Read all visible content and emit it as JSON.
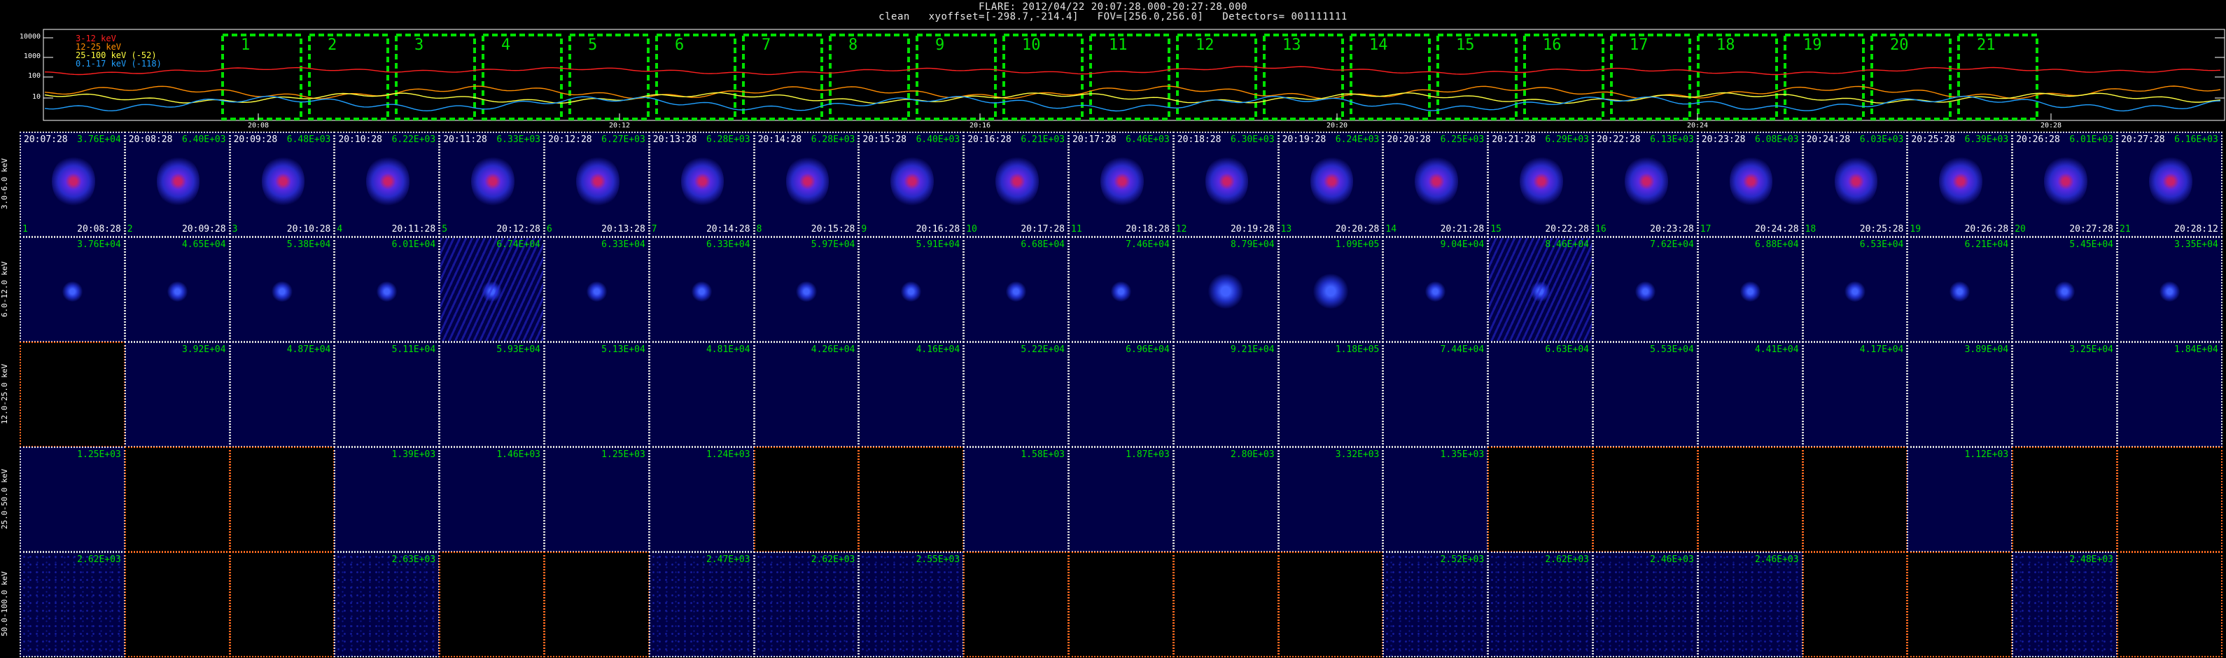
{
  "header": {
    "line1": "FLARE: 2012/04/22 20:07:28.000-20:27:28.000",
    "line2": "clean   xyoffset=[-298.7,-214.4]   FOV=[256.0,256.0]   Detectors= 001111111"
  },
  "lightcurve": {
    "y_ticks": [
      "10000",
      "1000",
      "100",
      "10"
    ],
    "legend": [
      {
        "label": "3-12 keV",
        "color": "#ff2020"
      },
      {
        "label": "12-25 keV",
        "color": "#ff8c00"
      },
      {
        "label": "25-100 keV (-52)",
        "color": "#ffff40"
      },
      {
        "label": "0.1-17 keV (-118)",
        "color": "#20a0ff"
      }
    ],
    "x_ticks": [
      "20:08",
      "20:12",
      "20:16",
      "20:20",
      "20:24",
      "20:28"
    ],
    "interval_labels": [
      "1",
      "2",
      "3",
      "4",
      "5",
      "6",
      "7",
      "8",
      "9",
      "10",
      "11",
      "12",
      "13",
      "14",
      "15",
      "16",
      "17",
      "18",
      "19",
      "20",
      "21"
    ],
    "interval_color": "#00e000"
  },
  "energy_bands": [
    "3.0-6.0 keV",
    "6.0-12.0 keV",
    "12.0-25.0 keV",
    "25.0-50.0 keV",
    "50.0-100.0 keV"
  ],
  "columns": [
    {
      "start": "20:07:28",
      "end": "20:08:28",
      "index": "1"
    },
    {
      "start": "20:08:28",
      "end": "20:09:28",
      "index": "2"
    },
    {
      "start": "20:09:28",
      "end": "20:10:28",
      "index": "3"
    },
    {
      "start": "20:10:28",
      "end": "20:11:28",
      "index": "4"
    },
    {
      "start": "20:11:28",
      "end": "20:12:28",
      "index": "5"
    },
    {
      "start": "20:12:28",
      "end": "20:13:28",
      "index": "6"
    },
    {
      "start": "20:13:28",
      "end": "20:14:28",
      "index": "7"
    },
    {
      "start": "20:14:28",
      "end": "20:15:28",
      "index": "8"
    },
    {
      "start": "20:15:28",
      "end": "20:16:28",
      "index": "9"
    },
    {
      "start": "20:16:28",
      "end": "20:17:28",
      "index": "10"
    },
    {
      "start": "20:17:28",
      "end": "20:18:28",
      "index": "11"
    },
    {
      "start": "20:18:28",
      "end": "20:19:28",
      "index": "12"
    },
    {
      "start": "20:19:28",
      "end": "20:20:28",
      "index": "13"
    },
    {
      "start": "20:20:28",
      "end": "20:21:28",
      "index": "14"
    },
    {
      "start": "20:21:28",
      "end": "20:22:28",
      "index": "15"
    },
    {
      "start": "20:22:28",
      "end": "20:23:28",
      "index": "16"
    },
    {
      "start": "20:23:28",
      "end": "20:24:28",
      "index": "17"
    },
    {
      "start": "20:24:28",
      "end": "20:25:28",
      "index": "18"
    },
    {
      "start": "20:25:28",
      "end": "20:26:28",
      "index": "19"
    },
    {
      "start": "20:26:28",
      "end": "20:27:28",
      "index": "20"
    },
    {
      "start": "20:27:28",
      "end": "20:28:12",
      "index": "21"
    }
  ],
  "grid": [
    [
      "3.76E+04",
      "6.40E+03",
      "6.48E+03",
      "6.22E+03",
      "6.33E+03",
      "6.27E+03",
      "6.28E+03",
      "6.28E+03",
      "6.40E+03",
      "6.21E+03",
      "6.46E+03",
      "6.30E+03",
      "6.24E+03",
      "6.25E+03",
      "6.29E+03",
      "6.13E+03",
      "6.08E+03",
      "6.03E+03",
      "6.39E+03",
      "6.01E+03",
      "6.16E+03"
    ],
    [
      "3.76E+04",
      "4.65E+04",
      "5.38E+04",
      "6.01E+04",
      "6.74E+04",
      "6.33E+04",
      "6.33E+04",
      "5.97E+04",
      "5.91E+04",
      "6.68E+04",
      "7.46E+04",
      "8.79E+04",
      "1.09E+05",
      "9.04E+04",
      "8.46E+04",
      "7.62E+04",
      "6.88E+04",
      "6.53E+04",
      "6.21E+04",
      "5.45E+04",
      "3.35E+04"
    ],
    [
      null,
      "3.92E+04",
      "4.87E+04",
      "5.11E+04",
      "5.93E+04",
      "5.13E+04",
      "4.81E+04",
      "4.26E+04",
      "4.16E+04",
      "5.22E+04",
      "6.96E+04",
      "9.21E+04",
      "1.18E+05",
      "7.44E+04",
      "6.63E+04",
      "5.53E+04",
      "4.41E+04",
      "4.17E+04",
      "3.89E+04",
      "3.25E+04",
      "1.84E+04"
    ],
    [
      "1.25E+03",
      null,
      null,
      "1.39E+03",
      "1.46E+03",
      "1.25E+03",
      "1.24E+03",
      null,
      null,
      "1.58E+03",
      "1.87E+03",
      "2.80E+03",
      "3.32E+03",
      "1.35E+03",
      null,
      null,
      null,
      null,
      "1.12E+03",
      null,
      null
    ],
    [
      "2.62E+03",
      null,
      null,
      "2.63E+03",
      null,
      null,
      "2.47E+03",
      "2.62E+03",
      "2.55E+03",
      null,
      null,
      null,
      null,
      "2.52E+03",
      "2.62E+03",
      "2.46E+03",
      "2.46E+03",
      null,
      null,
      "2.48E+03",
      null
    ]
  ],
  "colors": {
    "image_bg": "#000046",
    "grid_white": "#d9d9d9",
    "grid_orange": "#ff6a20",
    "peak_text": "#00e000"
  }
}
